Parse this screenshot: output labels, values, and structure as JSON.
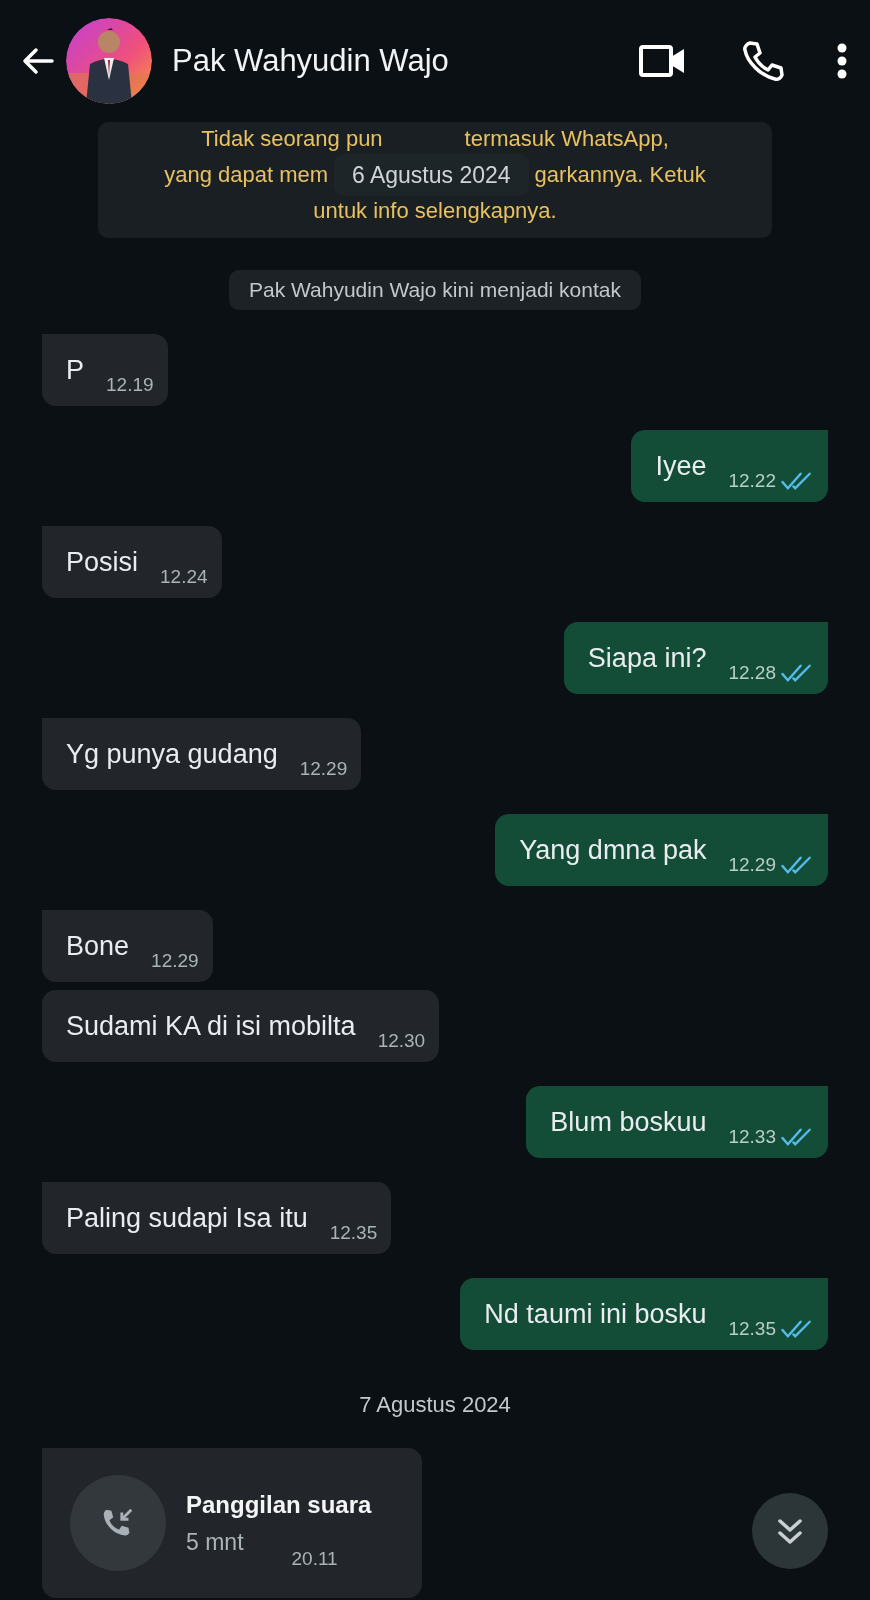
{
  "header": {
    "contact_name": "Pak Wahyudin Wajo"
  },
  "encryption_notice": {
    "lines": [
      {
        "left": "Tidak seorang pun",
        "right": "termasuk WhatsApp,"
      },
      {
        "left": "yang dapat mem",
        "right": "garkannya. Ketuk"
      },
      {
        "left": "untuk info selengkapnya."
      }
    ]
  },
  "date_pill_1": "6 Agustus 2024",
  "system_message": "Pak Wahyudin Wajo kini menjadi kontak",
  "messages": [
    {
      "kind": "incoming",
      "tail": true,
      "text": "P",
      "time": "12.19"
    },
    {
      "kind": "outgoing",
      "tail": true,
      "text": "Iyee",
      "time": "12.22",
      "read": true
    },
    {
      "kind": "incoming",
      "tail": true,
      "text": "Posisi",
      "time": "12.24"
    },
    {
      "kind": "outgoing",
      "tail": true,
      "text": "Siapa ini?",
      "time": "12.28",
      "read": true
    },
    {
      "kind": "incoming",
      "tail": true,
      "text": "Yg punya gudang",
      "time": "12.29"
    },
    {
      "kind": "outgoing",
      "tail": true,
      "text": "Yang dmna pak",
      "time": "12.29",
      "read": true
    },
    {
      "kind": "incoming",
      "tail": true,
      "text": "Bone",
      "time": "12.29"
    },
    {
      "kind": "incoming",
      "tail": false,
      "text": "Sudami KA di isi mobilta",
      "time": "12.30"
    },
    {
      "kind": "outgoing",
      "tail": true,
      "text": "Blum boskuu",
      "time": "12.33",
      "read": true
    },
    {
      "kind": "incoming",
      "tail": true,
      "text": "Paling sudapi Isa itu",
      "time": "12.35"
    },
    {
      "kind": "outgoing",
      "tail": true,
      "text": "Nd taumi ini bosku",
      "time": "12.35",
      "read": true
    }
  ],
  "date_pill_2": "7 Agustus 2024",
  "call": {
    "title": "Panggilan suara",
    "duration": "5 mnt",
    "time": "20.11"
  }
}
